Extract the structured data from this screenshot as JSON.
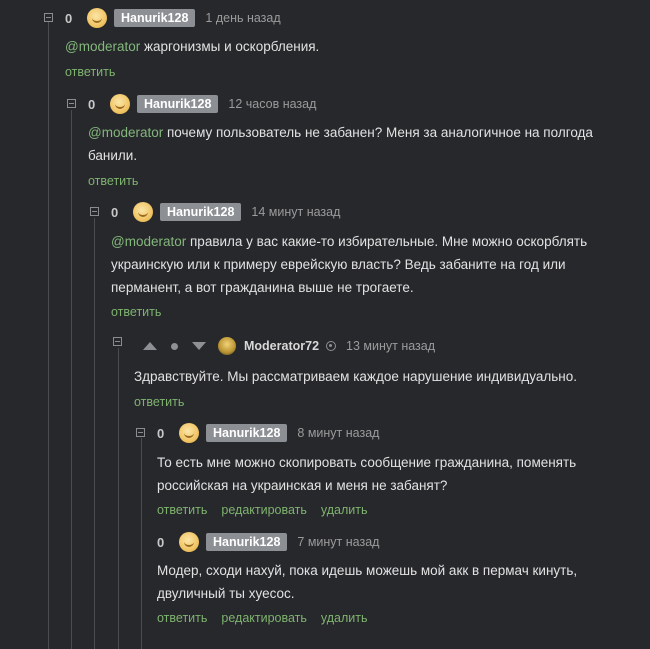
{
  "comments": [
    {
      "rating": "0",
      "user": "Hanurik128",
      "time": "1 день назад",
      "mention": "@moderator",
      "lines": [
        "жаргонизмы и оскорбления."
      ],
      "actions": [
        "ответить"
      ]
    },
    {
      "rating": "0",
      "user": "Hanurik128",
      "time": "12 часов назад",
      "mention": "@moderator",
      "lines": [
        "почему пользователь не забанен? Меня за аналогичное на полгода",
        "банили."
      ],
      "actions": [
        "ответить"
      ]
    },
    {
      "rating": "0",
      "user": "Hanurik128",
      "time": "14 минут назад",
      "mention": "@moderator",
      "lines": [
        "правила у вас какие-то избирательные. Мне можно оскорблять",
        "украинскую или к примеру еврейскую власть? Ведь забаните на год или",
        "перманент, а вот гражданина выше не трогаете."
      ],
      "actions": [
        "ответить"
      ]
    },
    {
      "user": "Moderator72",
      "time": "13 минут назад",
      "lines": [
        "Здравствуйте. Мы рассматриваем каждое нарушение индивидуально."
      ],
      "actions": [
        "ответить"
      ]
    },
    {
      "rating": "0",
      "user": "Hanurik128",
      "time": "8 минут назад",
      "lines": [
        "То есть мне можно скопировать сообщение гражданина, поменять",
        "российская на украинская и меня не забанят?"
      ],
      "actions": [
        "ответить",
        "редактировать",
        "удалить"
      ]
    },
    {
      "rating": "0",
      "user": "Hanurik128",
      "time": "7 минут назад",
      "lines": [
        "Модер, сходи нахуй, пока идешь можешь мой акк в пермач кинуть,",
        "двуличный ты хуесос."
      ],
      "actions": [
        "ответить",
        "редактировать",
        "удалить"
      ]
    }
  ],
  "icons": {
    "collapse": "collapse-toggle-icon",
    "avatar": "user-avatar-icon",
    "upvote": "upvote-arrow-icon",
    "downvote": "downvote-arrow-icon",
    "moderator_badge": "moderator-badge-icon"
  },
  "colors": {
    "background": "#26282b",
    "link": "#7fb36f",
    "mention": "#84b77c",
    "badge": "#8c8f94"
  }
}
